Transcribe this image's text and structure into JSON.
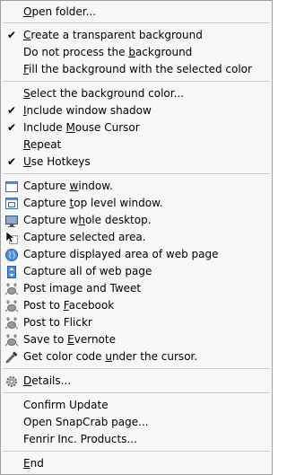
{
  "menu": {
    "open_folder": {
      "pre": "",
      "key": "O",
      "post": "pen folder..."
    },
    "transparent_bg": {
      "pre": "",
      "key": "C",
      "post": "reate a transparent background",
      "checked": "✔"
    },
    "no_process_bg": {
      "pre": "Do not process the ",
      "key": "b",
      "post": "ackground"
    },
    "fill_bg": {
      "pre": "",
      "key": "F",
      "post": "ill the background with the selected color"
    },
    "select_bg_color": {
      "pre": "",
      "key": "S",
      "post": "elect the background color..."
    },
    "include_shadow": {
      "pre": "",
      "key": "I",
      "post": "nclude window shadow",
      "checked": "✔"
    },
    "include_cursor": {
      "pre": "Include ",
      "key": "M",
      "post": "ouse Cursor",
      "checked": "✔"
    },
    "repeat": {
      "pre": "",
      "key": "R",
      "post": "epeat"
    },
    "use_hotkeys": {
      "pre": "",
      "key": "U",
      "post": "se Hotkeys",
      "checked": "✔"
    },
    "capture_window": {
      "pre": "Capture ",
      "key": "w",
      "post": "indow."
    },
    "capture_top_level": {
      "pre": "Capture ",
      "key": "t",
      "post": "op level window."
    },
    "capture_whole_desktop": {
      "pre": "Capture w",
      "key": "h",
      "post": "ole desktop."
    },
    "capture_selected_area": {
      "pre": "Capture selected area.",
      "key": "",
      "post": ""
    },
    "capture_displayed_web": {
      "pre": "Capture displayed area of web page",
      "key": "",
      "post": ""
    },
    "capture_all_web": {
      "pre": "Capture all of web page",
      "key": "",
      "post": ""
    },
    "post_image_tweet": {
      "pre": "Post image and Tweet",
      "key": "",
      "post": ""
    },
    "post_facebook": {
      "pre": "Post to ",
      "key": "F",
      "post": "acebook"
    },
    "post_flickr": {
      "pre": "Post to Flickr",
      "key": "",
      "post": ""
    },
    "save_evernote": {
      "pre": "Save to ",
      "key": "E",
      "post": "vernote"
    },
    "get_color_code": {
      "pre": "Get color code ",
      "key": "u",
      "post": "nder the cursor."
    },
    "details": {
      "pre": "",
      "key": "D",
      "post": "etails..."
    },
    "confirm_update": {
      "pre": "Confirm Update",
      "key": "",
      "post": ""
    },
    "open_snapcrab": {
      "pre": "Open SnapCrab page...",
      "key": "",
      "post": ""
    },
    "fenrir_products": {
      "pre": "Fenrir Inc. Products...",
      "key": "",
      "post": ""
    },
    "end": {
      "pre": "",
      "key": "E",
      "post": "nd"
    }
  }
}
